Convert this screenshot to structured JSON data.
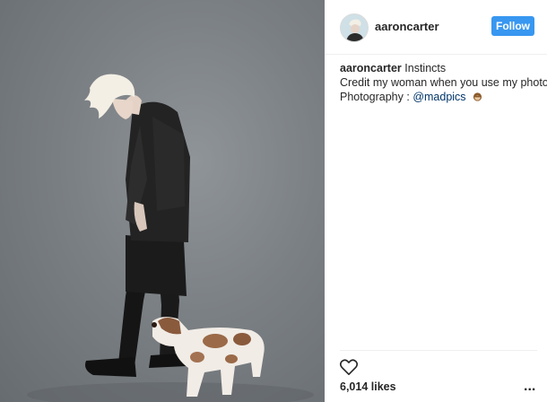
{
  "post": {
    "image_alt": "Man with bleached hair in black leather jacket walking with merle puppy"
  },
  "header": {
    "username": "aaroncarter",
    "follow_label": "Follow"
  },
  "caption": {
    "author": "aaroncarter",
    "title": "Instincts",
    "line2": "Credit my woman when you use my photos",
    "line3_prefix": "Photography : ",
    "mention": "@madpics",
    "emoji": "monkey-emoji"
  },
  "actions": {
    "like_icon": "heart-icon",
    "likes_text": "6,014 likes",
    "more_label": "..."
  },
  "colors": {
    "accent": "#3897f0",
    "mention": "#003569"
  }
}
